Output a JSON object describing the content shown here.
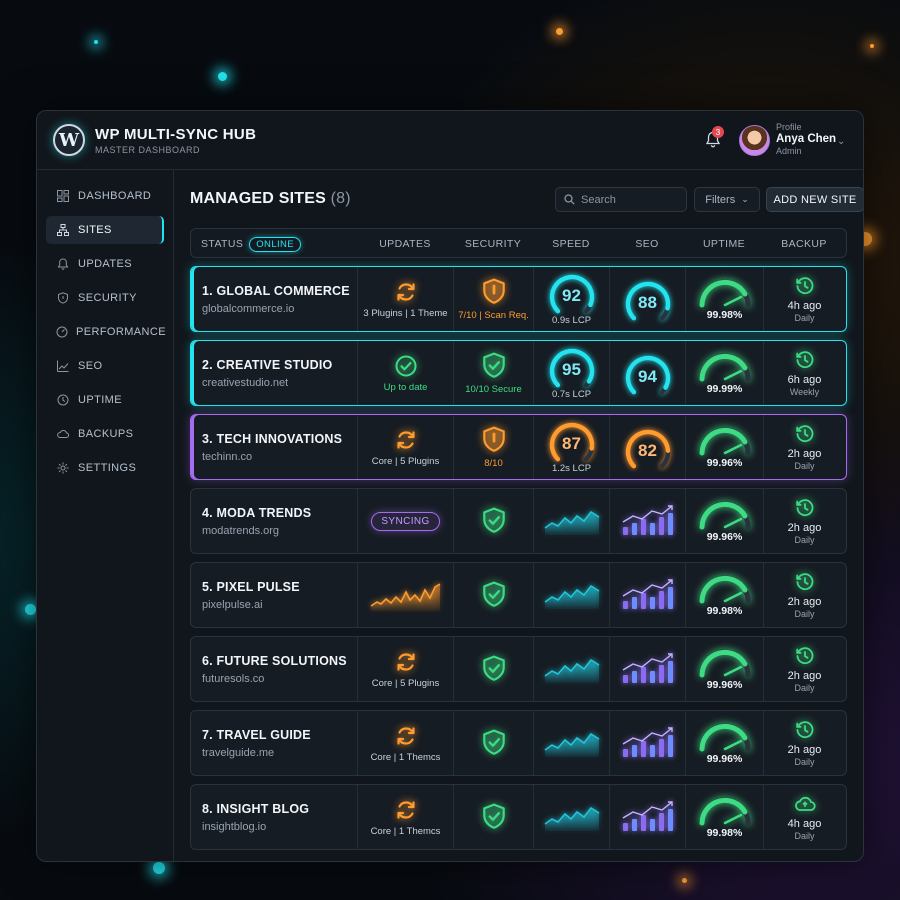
{
  "brand": {
    "title": "WP MULTI-SYNC HUB",
    "subtitle": "MASTER DASHBOARD"
  },
  "notifications": {
    "count": "3"
  },
  "profile": {
    "label": "Profile",
    "name": "Anya Chen",
    "role": "Admin"
  },
  "sidebar": {
    "items": [
      {
        "label": "DASHBOARD",
        "icon": "grid-icon",
        "active": false
      },
      {
        "label": "SITES",
        "icon": "sitemap-icon",
        "active": true
      },
      {
        "label": "UPDATES",
        "icon": "bell-icon",
        "active": false
      },
      {
        "label": "SECURITY",
        "icon": "shield-icon",
        "active": false
      },
      {
        "label": "PERFORMANCE",
        "icon": "speedometer-icon",
        "active": false
      },
      {
        "label": "SEO",
        "icon": "trend-icon",
        "active": false
      },
      {
        "label": "UPTIME",
        "icon": "clock-icon",
        "active": false
      },
      {
        "label": "BACKUPS",
        "icon": "cloud-icon",
        "active": false
      },
      {
        "label": "SETTINGS",
        "icon": "gear-icon",
        "active": false
      }
    ]
  },
  "main": {
    "title": "MANAGED SITES",
    "count": "(8)",
    "search_placeholder": "Search",
    "filters_label": "Filters",
    "add_label": "ADD NEW SITE"
  },
  "columns": {
    "status": "STATUS",
    "online": "ONLINE",
    "updates": "UPDATES",
    "security": "SECURITY",
    "speed": "SPEED",
    "seo": "SEO",
    "uptime": "UPTIME",
    "backup": "BACKUP"
  },
  "colors": {
    "cyan": "#22e3ee",
    "orange": "#ff9b2f",
    "green": "#3ddc84",
    "purple": "#a56cf0"
  },
  "sites": [
    {
      "name": "1. GLOBAL COMMERCE",
      "url": "globalcommerce.io",
      "highlight": "cyan",
      "updates": {
        "type": "sync",
        "text": "3 Plugins | 1 Theme"
      },
      "security": {
        "type": "warn",
        "text": "7/10 | Scan Req."
      },
      "speed": {
        "type": "gauge",
        "value": "92",
        "fraction": 0.92,
        "color": "cyan",
        "text": "0.9s LCP"
      },
      "seo": {
        "type": "gauge",
        "value": "88",
        "fraction": 0.88,
        "color": "cyan"
      },
      "uptime": "99.98%",
      "backup_ago": "4h ago",
      "backup_freq": "Daily",
      "backup_icon": "clock-icon"
    },
    {
      "name": "2. CREATIVE STUDIO",
      "url": "creativestudio.net",
      "highlight": "cyan",
      "updates": {
        "type": "ok",
        "text": "Up to date"
      },
      "security": {
        "type": "ok",
        "text": "10/10 Secure"
      },
      "speed": {
        "type": "gauge",
        "value": "95",
        "fraction": 0.95,
        "color": "cyan",
        "text": "0.7s LCP"
      },
      "seo": {
        "type": "gauge",
        "value": "94",
        "fraction": 0.94,
        "color": "cyan"
      },
      "uptime": "99.99%",
      "backup_ago": "6h ago",
      "backup_freq": "Weekly",
      "backup_icon": "clock-icon"
    },
    {
      "name": "3. TECH INNOVATIONS",
      "url": "techinn.co",
      "highlight": "purple",
      "updates": {
        "type": "sync",
        "text": "Core | 5 Plugins"
      },
      "security": {
        "type": "warn",
        "text": "8/10"
      },
      "speed": {
        "type": "gauge",
        "value": "87",
        "fraction": 0.87,
        "color": "orange",
        "text": "1.2s LCP"
      },
      "seo": {
        "type": "gauge",
        "value": "82",
        "fraction": 0.82,
        "color": "orange"
      },
      "uptime": "99.96%",
      "backup_ago": "2h ago",
      "backup_freq": "Daily",
      "backup_icon": "clock-icon"
    },
    {
      "name": "4. MODA TRENDS",
      "url": "modatrends.org",
      "highlight": "",
      "updates": {
        "type": "syncing",
        "text": "SYNCING"
      },
      "security": {
        "type": "ok",
        "text": ""
      },
      "speed": {
        "type": "area"
      },
      "seo": {
        "type": "bars"
      },
      "uptime": "99.96%",
      "backup_ago": "2h ago",
      "backup_freq": "Daily",
      "backup_icon": "clock-icon"
    },
    {
      "name": "5. PIXEL PULSE",
      "url": "pixelpulse.ai",
      "highlight": "",
      "updates": {
        "type": "spark",
        "text": ""
      },
      "security": {
        "type": "ok",
        "text": ""
      },
      "speed": {
        "type": "area"
      },
      "seo": {
        "type": "bars"
      },
      "uptime": "99.98%",
      "backup_ago": "2h ago",
      "backup_freq": "Daily",
      "backup_icon": "clock-icon"
    },
    {
      "name": "6. FUTURE SOLUTIONS",
      "url": "futuresols.co",
      "highlight": "",
      "updates": {
        "type": "sync",
        "text": "Core | 5 Plugins"
      },
      "security": {
        "type": "ok",
        "text": ""
      },
      "speed": {
        "type": "area"
      },
      "seo": {
        "type": "bars"
      },
      "uptime": "99.96%",
      "backup_ago": "2h ago",
      "backup_freq": "Daily",
      "backup_icon": "clock-icon"
    },
    {
      "name": "7. TRAVEL GUIDE",
      "url": "travelguide.me",
      "highlight": "",
      "updates": {
        "type": "sync",
        "text": "Core | 1 Themcs"
      },
      "security": {
        "type": "ok",
        "text": ""
      },
      "speed": {
        "type": "area"
      },
      "seo": {
        "type": "bars"
      },
      "uptime": "99.96%",
      "backup_ago": "2h ago",
      "backup_freq": "Daily",
      "backup_icon": "clock-icon"
    },
    {
      "name": "8. INSIGHT BLOG",
      "url": "insightblog.io",
      "highlight": "",
      "updates": {
        "type": "sync",
        "text": "Core | 1 Themcs"
      },
      "security": {
        "type": "ok",
        "text": ""
      },
      "speed": {
        "type": "area"
      },
      "seo": {
        "type": "bars"
      },
      "uptime": "99.98%",
      "backup_ago": "4h ago",
      "backup_freq": "Daily",
      "backup_icon": "cloud-icon"
    }
  ]
}
